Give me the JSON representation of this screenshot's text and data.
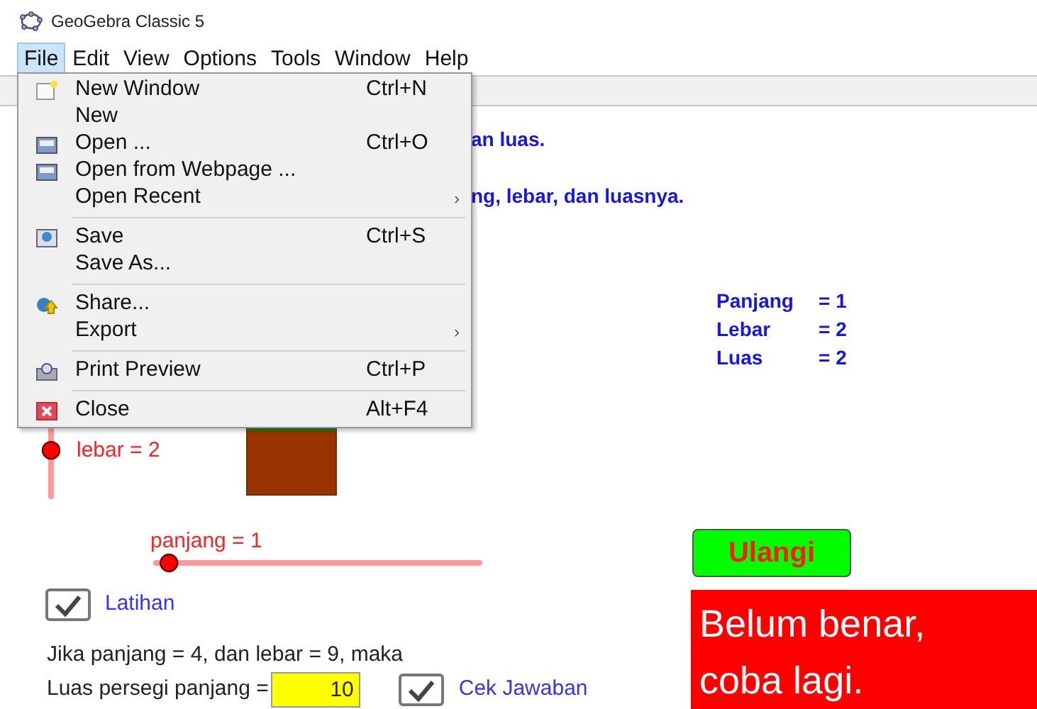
{
  "window": {
    "title": "GeoGebra Classic 5"
  },
  "menubar": [
    {
      "label": "File",
      "selected": true
    },
    {
      "label": "Edit",
      "selected": false
    },
    {
      "label": "View",
      "selected": false
    },
    {
      "label": "Options",
      "selected": false
    },
    {
      "label": "Tools",
      "selected": false
    },
    {
      "label": "Window",
      "selected": false
    },
    {
      "label": "Help",
      "selected": false
    }
  ],
  "file_menu": [
    {
      "kind": "item",
      "label": "New Window",
      "shortcut": "Ctrl+N"
    },
    {
      "kind": "item",
      "label": "New"
    },
    {
      "kind": "item",
      "label": "Open ...",
      "shortcut": "Ctrl+O"
    },
    {
      "kind": "item",
      "label": "Open from Webpage ..."
    },
    {
      "kind": "item",
      "label": "Open Recent",
      "submenu_arrow": "›"
    },
    {
      "kind": "separator"
    },
    {
      "kind": "item",
      "label": "Save",
      "shortcut": "Ctrl+S"
    },
    {
      "kind": "item",
      "label": "Save As..."
    },
    {
      "kind": "separator"
    },
    {
      "kind": "item",
      "label": "Share..."
    },
    {
      "kind": "item",
      "label": "Export",
      "submenu_arrow": "›"
    },
    {
      "kind": "separator"
    },
    {
      "kind": "item",
      "label": "Print Preview",
      "shortcut": "Ctrl+P"
    },
    {
      "kind": "separator"
    },
    {
      "kind": "item",
      "label": "Close",
      "shortcut": "Alt+F4"
    }
  ],
  "canvas": {
    "instructions": [
      "an luas.",
      "ng, lebar, dan luasnya."
    ],
    "results": [
      {
        "name": "Panjang",
        "value": "= 1"
      },
      {
        "name": "Lebar",
        "value": "= 2"
      },
      {
        "name": "Luas",
        "value": "= 2"
      }
    ],
    "sliders": [
      {
        "label": "lebar = 2",
        "kind": "vertical",
        "level": 0.27
      },
      {
        "label": "panjang = 1",
        "kind": "horizontal",
        "level": 0.04
      }
    ],
    "latihan_checkbox": {
      "label": "Latihan",
      "checked": true
    },
    "question": "Jika panjang = 4, dan lebar = 9, maka",
    "answer_label": "Luas persegi panjang =",
    "answer_field": {
      "value": "10"
    },
    "check_checkbox": {
      "label": "Cek Jawaban",
      "checked": true
    },
    "reset_button": "Ulangi",
    "feedback": {
      "correct": false,
      "lines": [
        "Belum benar,",
        "coba lagi."
      ]
    }
  }
}
